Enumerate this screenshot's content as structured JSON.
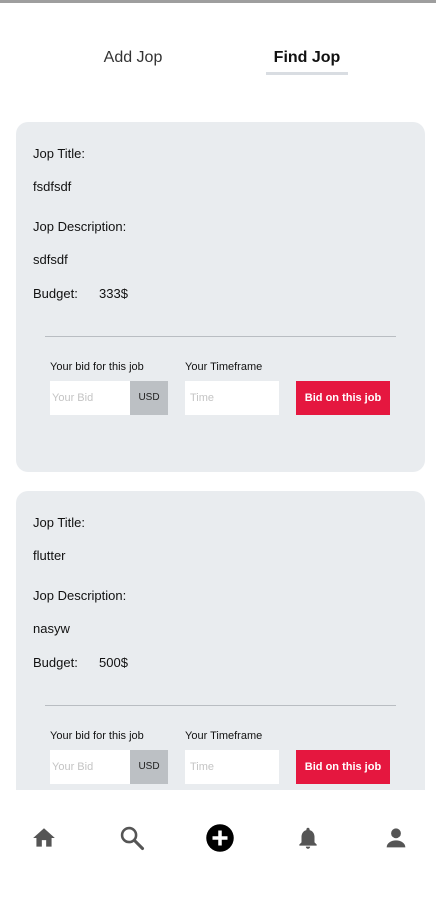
{
  "tabs": {
    "add_label": "Add Jop",
    "find_label": "Find Jop"
  },
  "jobs": [
    {
      "title_label": "Jop Title:",
      "title": "fsdfsdf",
      "description_label": "Jop Description:",
      "description": "sdfsdf",
      "budget_label": "Budget:",
      "budget": "333$",
      "bid_label": "Your bid for this job",
      "bid_placeholder": "Your Bid",
      "currency": "USD",
      "timeframe_label": "Your Timeframe",
      "timeframe_placeholder": "Time",
      "bid_button": "Bid on this job"
    },
    {
      "title_label": "Jop Title:",
      "title": "flutter",
      "description_label": "Jop Description:",
      "description": "nasyw",
      "budget_label": "Budget:",
      "budget": "500$",
      "bid_label": "Your bid for this job",
      "bid_placeholder": "Your Bid",
      "currency": "USD",
      "timeframe_label": "Your Timeframe",
      "timeframe_placeholder": "Time",
      "bid_button": "Bid on this job"
    }
  ],
  "bottom_nav": {
    "items": [
      "home-icon",
      "search-icon",
      "add-circle-icon",
      "bell-icon",
      "person-icon"
    ]
  },
  "colors": {
    "accent": "#e5173f",
    "card_bg": "#e9ecef",
    "currency_bg": "#bcc0c4"
  }
}
